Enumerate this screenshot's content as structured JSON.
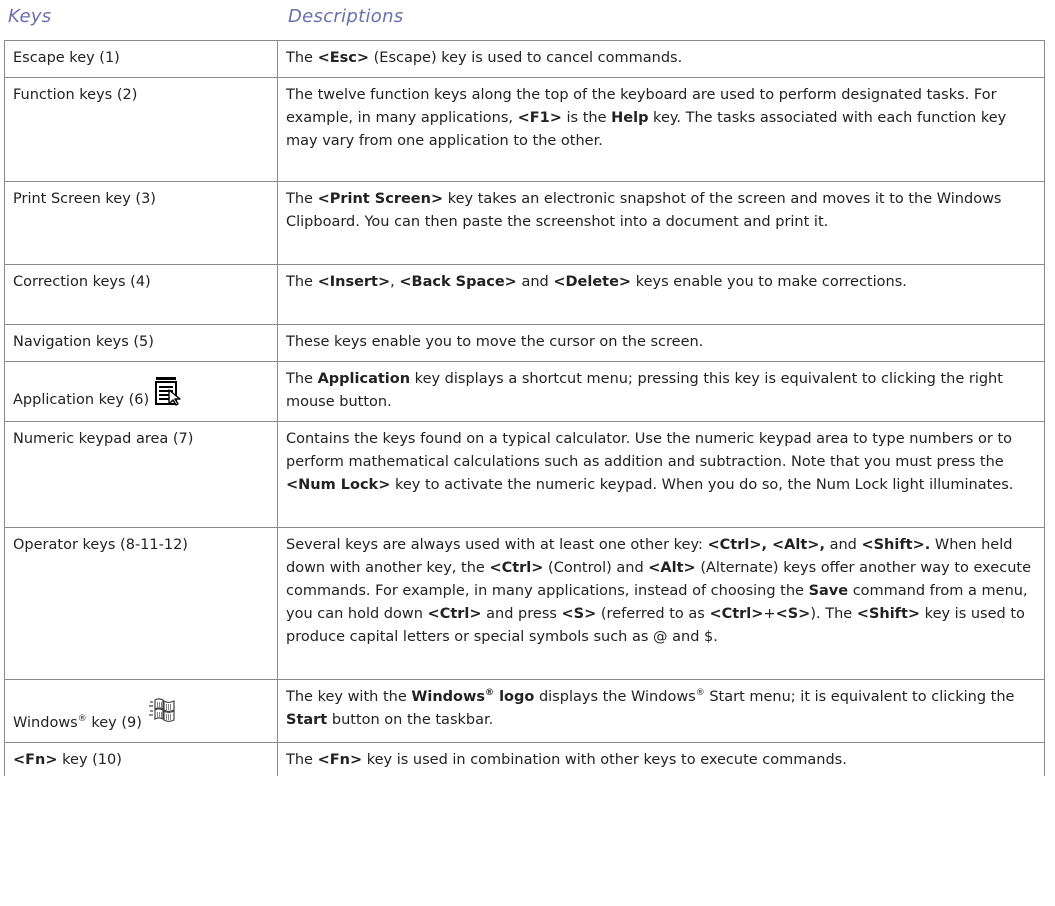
{
  "header": {
    "keys_label": "Keys",
    "descriptions_label": "Descriptions"
  },
  "rows": [
    {
      "key": "Escape key (1)",
      "desc": {
        "p0": "The ",
        "b0": "<Esc>",
        "p1": " (Escape) key is used to cancel commands."
      }
    },
    {
      "key": "Function keys (2)",
      "desc": {
        "p0": "The twelve function keys along the top of the keyboard are used to perform designated tasks. For example, in many applications, ",
        "b0": "<F1>",
        "p1": " is the ",
        "b1": "Help",
        "p2": " key. The tasks associated with each function key may vary from one application to the other."
      }
    },
    {
      "key": "Print Screen key (3)",
      "desc": {
        "p0": "The ",
        "b0": "<Print Screen>",
        "p1": " key takes an electronic snapshot of the screen and moves it to the Windows Clipboard. You can then paste the screenshot into a document and print it."
      }
    },
    {
      "key": "Correction keys (4)",
      "desc": {
        "p0": "The ",
        "b0": "<Insert>",
        "p1": ", ",
        "b1": "<Back Space>",
        "p2": " and ",
        "b2": "<Delete>",
        "p3": " keys enable you to make corrections."
      }
    },
    {
      "key": "Navigation keys (5)",
      "desc": {
        "p0": "These keys enable you to move the cursor on the screen."
      }
    },
    {
      "key": "Application key (6)",
      "icon": "application-key-icon",
      "desc": {
        "p0": "The ",
        "b0": "Application",
        "p1": " key displays a shortcut menu; pressing this key is equivalent to clicking the right mouse button."
      }
    },
    {
      "key": "Numeric keypad area (7)",
      "desc": {
        "p0": "Contains the keys found on a typical calculator. Use the numeric keypad area to type numbers or to perform mathematical calculations such as addition and subtraction. Note that you must press the ",
        "b0": "<Num Lock>",
        "p1": " key to activate the numeric keypad. When you do so, the Num Lock light illuminates."
      }
    },
    {
      "key": "Operator keys (8-11-12)",
      "desc": {
        "p0": "Several keys are always used with at least one other key: ",
        "b0": "<Ctrl>, <Alt>,",
        "p1": " and ",
        "b1": "<Shift>.",
        "p2": " When held down with another key, the ",
        "b2": "<Ctrl>",
        "p3": " (Control) and ",
        "b3": "<Alt>",
        "p4": " (Alternate) keys offer another way to execute commands. For example, in many applications, instead of choosing the ",
        "b4": "Save",
        "p5": " command from a menu, you can hold down ",
        "b5": "<Ctrl>",
        "p6": " and press ",
        "b6": "<S>",
        "p7": " (referred to as ",
        "b7": "<Ctrl>",
        "p8": "+",
        "b8": "<S>",
        "p9": "). The ",
        "b9": "<Shift>",
        "p10": " key is used to produce capital letters or special symbols such as @ and $."
      }
    },
    {
      "key_prefix": "Windows",
      "key_sup": "®",
      "key_suffix": " key (9)",
      "icon": "windows-logo-icon",
      "desc": {
        "p0": "The key with the ",
        "b0": "Windows",
        "b0_sup": "®",
        "b0b": " logo",
        "p1": " displays the Windows",
        "p1_sup": "®",
        "p1b": " Start menu; it is equivalent to clicking the ",
        "b1": "Start",
        "p2": " button on the taskbar."
      }
    },
    {
      "key_bold": "<Fn>",
      "key_suffix": " key (10)",
      "desc": {
        "p0": "The ",
        "b0": "<Fn>",
        "p1": " key is used in combination with other keys to execute commands."
      }
    }
  ]
}
